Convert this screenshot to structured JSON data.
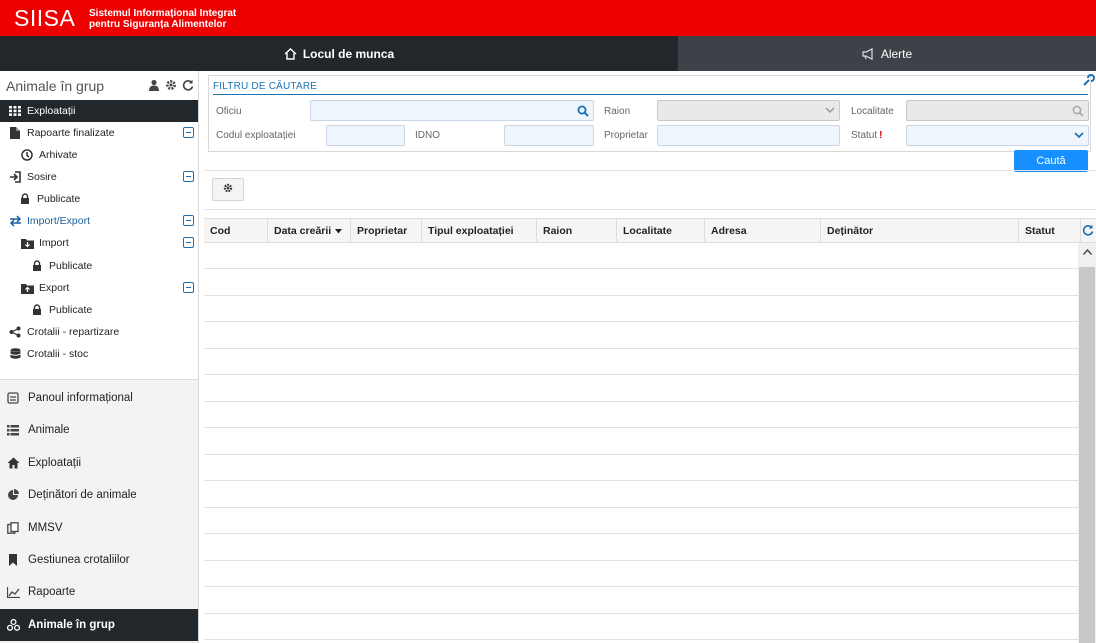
{
  "header": {
    "logo": "SIISA",
    "subtitle_line1": "Sistemul Informațional Integrat",
    "subtitle_line2": "pentru Siguranța Alimentelor"
  },
  "nav": {
    "work": "Locul de munca",
    "alerts": "Alerte"
  },
  "sidebar": {
    "title": "Animale în grup",
    "items": [
      {
        "label": "Exploatații",
        "icon": "grid-icon"
      },
      {
        "label": "Rapoarte finalizate",
        "icon": "file-icon"
      },
      {
        "label": "Arhivate",
        "icon": "archive-icon"
      },
      {
        "label": "Sosire",
        "icon": "sign-in-icon"
      },
      {
        "label": "Publicate",
        "icon": "lock-icon"
      },
      {
        "label": "Import/Export",
        "icon": "exchange-icon"
      },
      {
        "label": "Import",
        "icon": "folder-download-icon"
      },
      {
        "label": "Publicate",
        "icon": "lock-icon"
      },
      {
        "label": "Export",
        "icon": "folder-upload-icon"
      },
      {
        "label": "Publicate",
        "icon": "lock-icon"
      },
      {
        "label": "Crotalii - repartizare",
        "icon": "share-icon"
      },
      {
        "label": "Crotalii - stoc",
        "icon": "database-icon"
      }
    ],
    "modules": [
      {
        "label": "Panoul informațional",
        "icon": "dashboard-icon"
      },
      {
        "label": "Animale",
        "icon": "list-icon"
      },
      {
        "label": "Exploatații",
        "icon": "home-icon"
      },
      {
        "label": "Deținători de animale",
        "icon": "pie-chart-icon"
      },
      {
        "label": "MMSV",
        "icon": "copy-icon"
      },
      {
        "label": "Gestiunea crotaliilor",
        "icon": "bookmark-icon"
      },
      {
        "label": "Rapoarte",
        "icon": "chart-icon"
      },
      {
        "label": "Animale în grup",
        "icon": "cubes-icon"
      }
    ]
  },
  "filter": {
    "title": "FILTRU DE CĂUTARE",
    "oficiu_label": "Oficiu",
    "raion_label": "Raion",
    "localitate_label": "Localitate",
    "cod_label": "Codul exploatației",
    "idno_label": "IDNO",
    "proprietar_label": "Proprietar",
    "statut_label": "Statut",
    "statut_required": "!",
    "oficiu_value": "",
    "raion_value": "",
    "localitate_value": "",
    "cod_value": "",
    "idno_value": "",
    "proprietar_value": "",
    "statut_value": "",
    "search_button": "Caută"
  },
  "table": {
    "columns": [
      "Cod",
      "Data creării",
      "Proprietar",
      "Tipul exploatației",
      "Raion",
      "Localitate",
      "Adresa",
      "Deținător",
      "Statut"
    ],
    "sorted_column": "Data creării",
    "rows": []
  },
  "colors": {
    "brand_red": "#ee0000",
    "nav_dark": "#22272c",
    "accent_blue": "#1790ff"
  }
}
